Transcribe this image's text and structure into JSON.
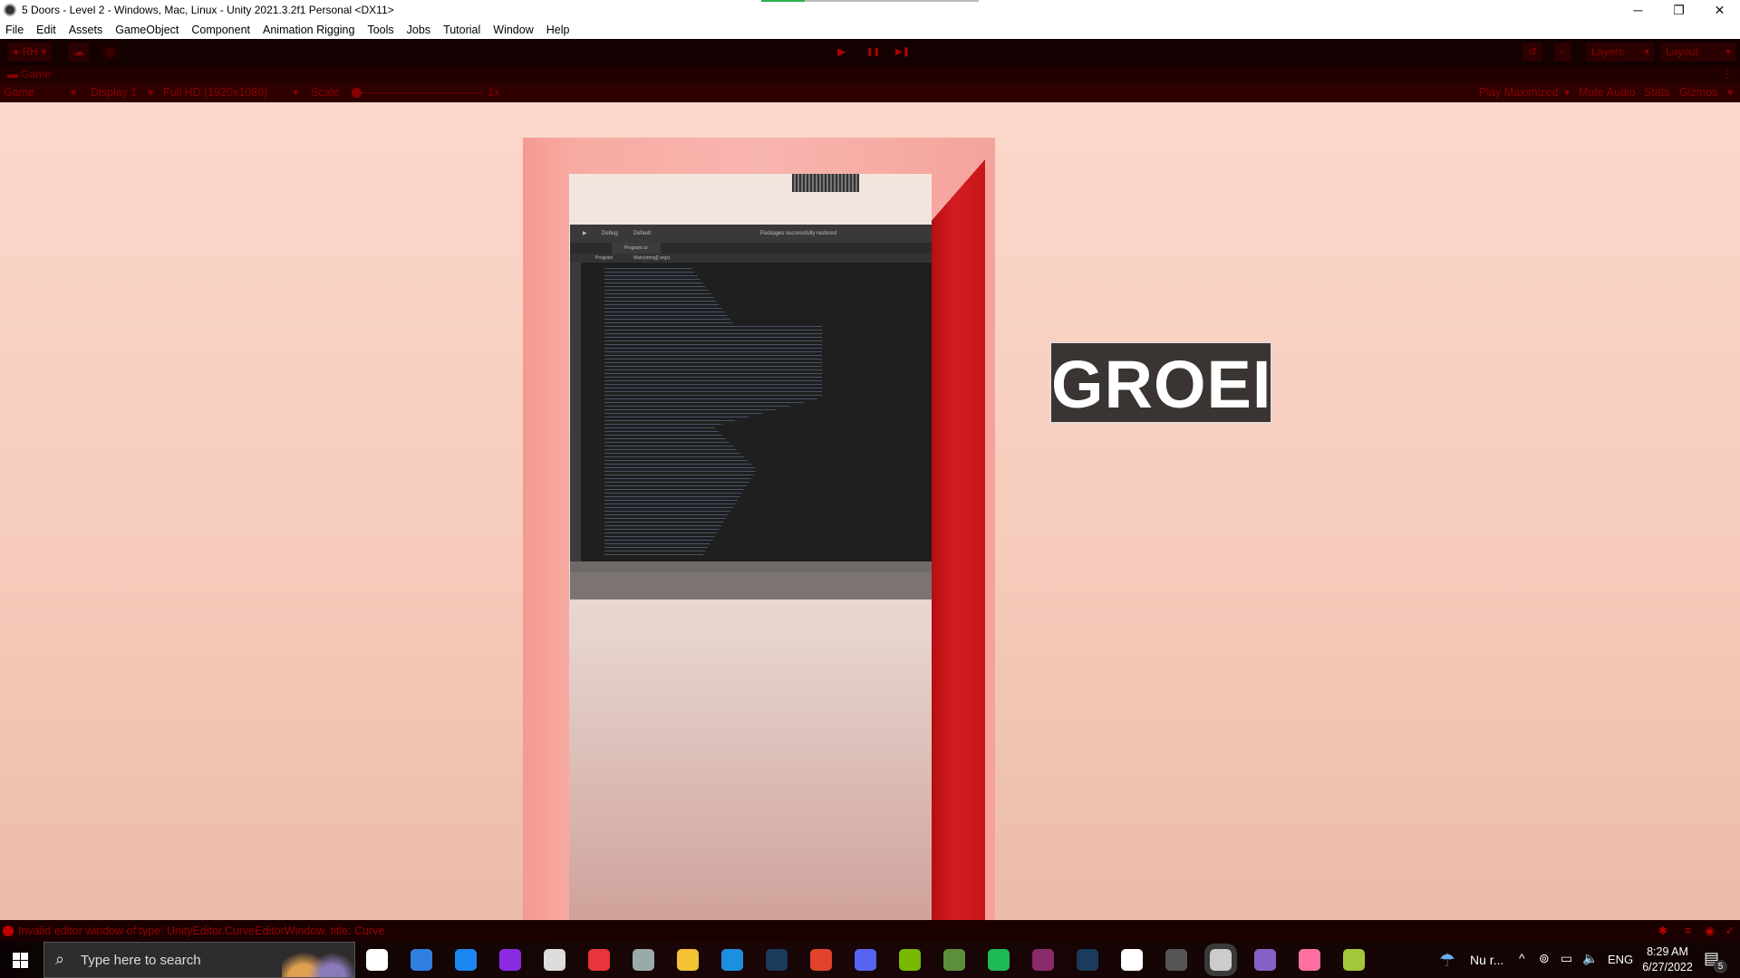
{
  "window": {
    "title": "5 Doors - Level 2 - Windows, Mac, Linux - Unity 2021.3.2f1 Personal <DX11>",
    "minimize": "─",
    "restore": "❐",
    "close": "✕"
  },
  "menu": [
    "File",
    "Edit",
    "Assets",
    "GameObject",
    "Component",
    "Animation Rigging",
    "Tools",
    "Jobs",
    "Tutorial",
    "Window",
    "Help"
  ],
  "toolbar": {
    "account": "RH ▾",
    "layers": "Layers",
    "layout": "Layout",
    "play": "▶",
    "pause": "❚❚",
    "step": "▶❚"
  },
  "game_tab": {
    "label": "Game"
  },
  "game_bar": {
    "view": "Game",
    "display": "Display 1",
    "resolution": "Full HD (1920x1080)",
    "scale_label": "Scale",
    "scale_value": "1x",
    "scale_fraction": 0.0,
    "play_maximized": "Play Maximized",
    "mute": "Mute Audio",
    "stats": "Stats",
    "gizmos": "Gizmos"
  },
  "scene": {
    "sign_text": "GROEI",
    "monitor": {
      "debug": "Debug",
      "default": "Default",
      "status": "Packages successfully restored",
      "file_tab": "Program.cs",
      "breadcrumb_class": "Program",
      "breadcrumb_method": "Main(string[] args)"
    }
  },
  "status_bar": {
    "message": "Invalid editor window of type: UnityEditor.CurveEditorWindow, title: Curve"
  },
  "taskbar": {
    "search_placeholder": "Type here to search",
    "weather": "Nu r...",
    "language": "ENG",
    "time": "8:29 AM",
    "date": "6/27/2022",
    "notifications": "5",
    "icons": [
      {
        "name": "task-view",
        "color": "#ffffff"
      },
      {
        "name": "todo",
        "color": "#2f7fe0"
      },
      {
        "name": "ubisoft",
        "color": "#1a86f0"
      },
      {
        "name": "cortana",
        "color": "#8a2be2"
      },
      {
        "name": "skyrim",
        "color": "#dddddd"
      },
      {
        "name": "ea",
        "color": "#e8343a"
      },
      {
        "name": "monitor-app",
        "color": "#9aa"
      },
      {
        "name": "file-explorer",
        "color": "#f3c235"
      },
      {
        "name": "mail",
        "color": "#1d8fe0"
      },
      {
        "name": "steam",
        "color": "#1b3a5c"
      },
      {
        "name": "chrome",
        "color": "#e0442f"
      },
      {
        "name": "discord",
        "color": "#5865f2"
      },
      {
        "name": "nvidia",
        "color": "#76b900"
      },
      {
        "name": "minecraft",
        "color": "#5d8f3a"
      },
      {
        "name": "spotify",
        "color": "#1db954"
      },
      {
        "name": "winrar",
        "color": "#8b2a6a"
      },
      {
        "name": "steam-2",
        "color": "#1b3a5c"
      },
      {
        "name": "notion",
        "color": "#ffffff"
      },
      {
        "name": "obs",
        "color": "#555"
      },
      {
        "name": "unity",
        "color": "#cccccc"
      },
      {
        "name": "visual-studio",
        "color": "#8661c5"
      },
      {
        "name": "paint",
        "color": "#ff6fa0"
      },
      {
        "name": "android-app",
        "color": "#a4c639"
      }
    ]
  }
}
